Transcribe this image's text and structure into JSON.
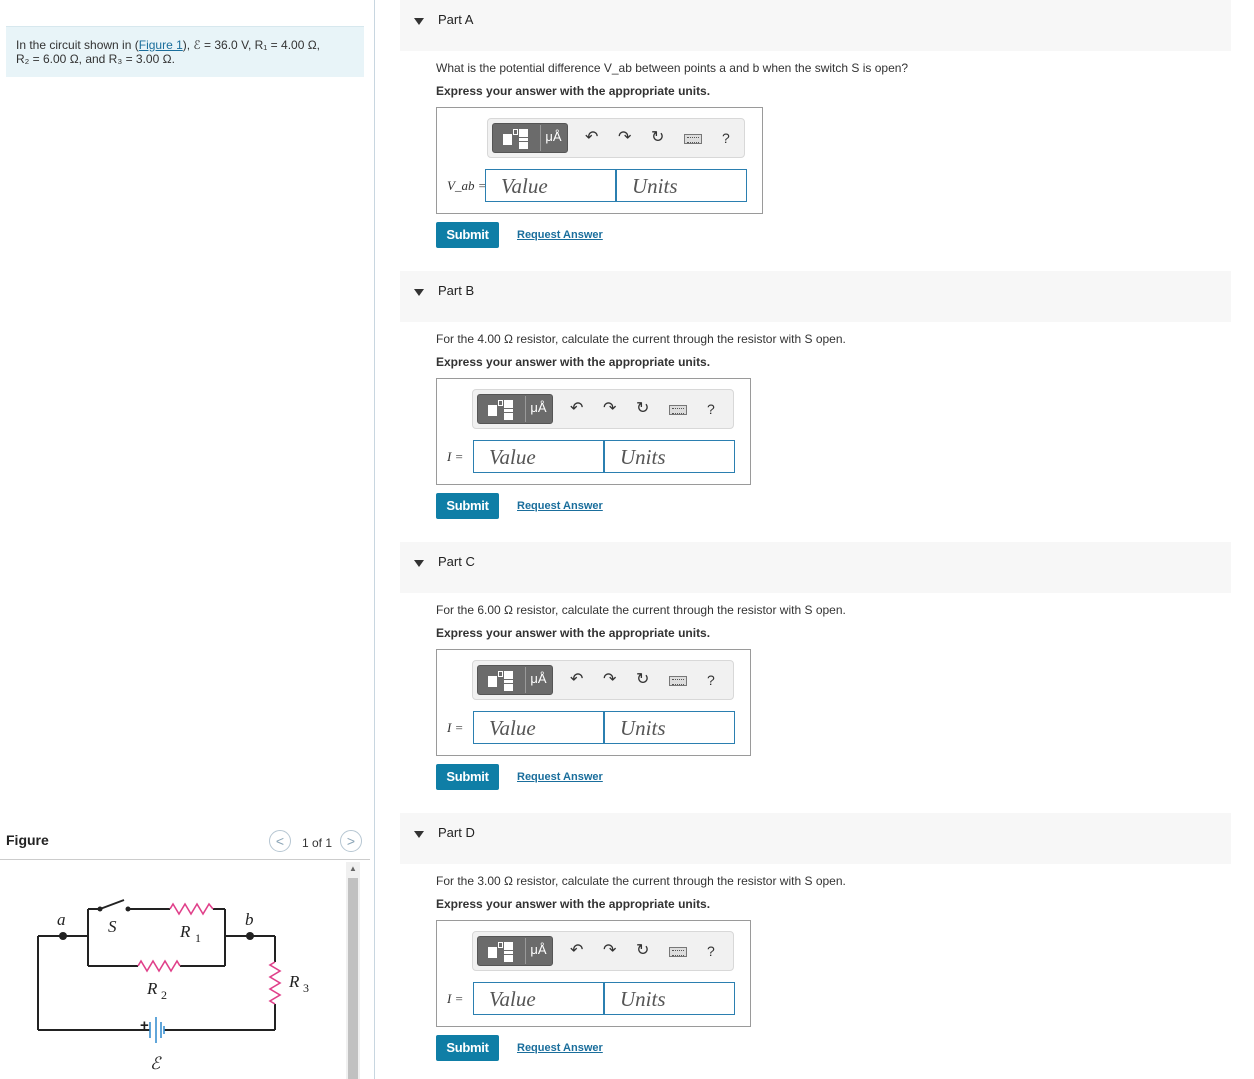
{
  "intro": {
    "prefix": "In the circuit shown in ",
    "figure_link": "Figure 1",
    "line1_rest": ", ℰ = 36.0 V, R₁ = 4.00 Ω,",
    "line2": "R₂ = 6.00 Ω, and R₃ = 3.00 Ω."
  },
  "figure": {
    "label": "Figure",
    "count": "1 of 1",
    "labels": {
      "a": "a",
      "b": "b",
      "S": "S",
      "R1": "R",
      "R1_sub": "1",
      "R2": "R",
      "R2_sub": "2",
      "R3": "R",
      "R3_sub": "3",
      "emf": "ℰ",
      "plus": "+"
    }
  },
  "toolbar": {
    "units_symbol": "μÅ",
    "help": "?"
  },
  "parts": [
    {
      "title": "Part A",
      "question": "What is the potential difference V_ab between points a and b when the switch S is open?",
      "instruction": "Express your answer with the appropriate units.",
      "input_label": "V_ab =",
      "value_placeholder": "Value",
      "units_placeholder": "Units",
      "submit": "Submit",
      "request": "Request Answer"
    },
    {
      "title": "Part B",
      "question": "For the 4.00 Ω resistor, calculate the current through the resistor with S open.",
      "instruction": "Express your answer with the appropriate units.",
      "input_label": "I =",
      "value_placeholder": "Value",
      "units_placeholder": "Units",
      "submit": "Submit",
      "request": "Request Answer"
    },
    {
      "title": "Part C",
      "question": "For the 6.00 Ω resistor, calculate the current through the resistor with S open.",
      "instruction": "Express your answer with the appropriate units.",
      "input_label": "I =",
      "value_placeholder": "Value",
      "units_placeholder": "Units",
      "submit": "Submit",
      "request": "Request Answer"
    },
    {
      "title": "Part D",
      "question": "For the 3.00 Ω resistor, calculate the current through the resistor with S open.",
      "instruction": "Express your answer with the appropriate units.",
      "input_label": "I =",
      "value_placeholder": "Value",
      "units_placeholder": "Units",
      "submit": "Submit",
      "request": "Request Answer"
    }
  ]
}
